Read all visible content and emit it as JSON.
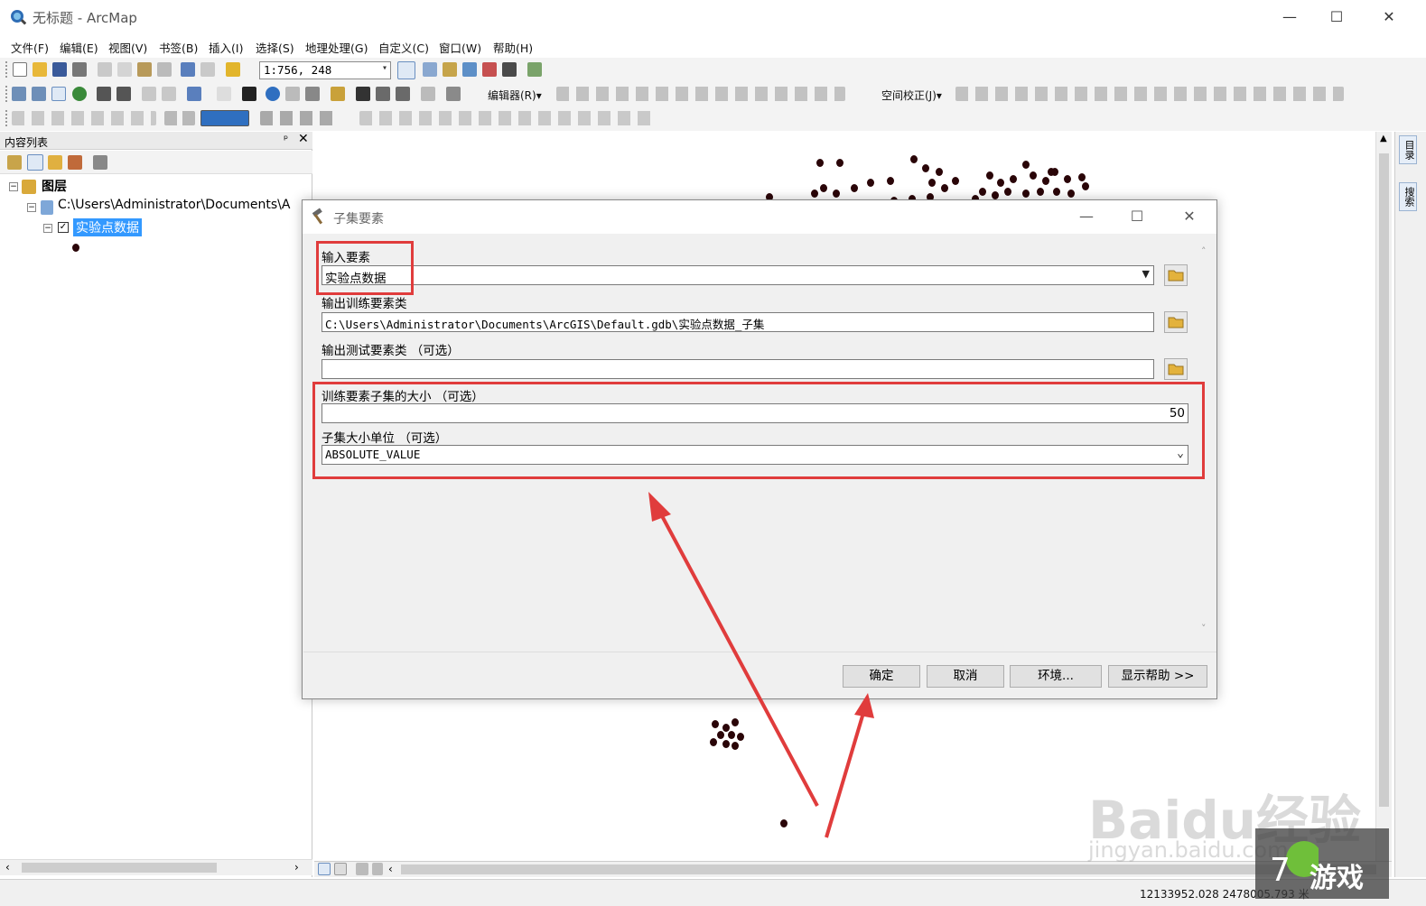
{
  "window": {
    "title": "无标题 - ArcMap",
    "minimize": "—",
    "maximize": "☐",
    "close": "✕"
  },
  "menu": [
    "文件(F)",
    "编辑(E)",
    "视图(V)",
    "书签(B)",
    "插入(I)",
    "选择(S)",
    "地理处理(G)",
    "自定义(C)",
    "窗口(W)",
    "帮助(H)"
  ],
  "toolbar": {
    "scale": "1:756, 248",
    "editor_label": "编辑器(R)▾",
    "spatial_adjust_label": "空间校正(J)▾"
  },
  "toc": {
    "title": "内容列表",
    "pin": "ᵖ",
    "close": "✕",
    "root": "图层",
    "datasource": "C:\\Users\\Administrator\\Documents\\A",
    "layer": "实验点数据",
    "expander_collapse": "−",
    "checkmark": "✓"
  },
  "side_tabs": [
    "目录",
    "搜索"
  ],
  "dialog": {
    "title": "子集要素",
    "input_features_label": "输入要素",
    "input_features_value": "实验点数据",
    "output_training_label": "输出训练要素类",
    "output_training_value": "C:\\Users\\Administrator\\Documents\\ArcGIS\\Default.gdb\\实验点数据_子集",
    "output_test_label": "输出测试要素类 （可选）",
    "output_test_value": "",
    "subset_size_label": "训练要素子集的大小 （可选）",
    "subset_size_value": "50",
    "subset_unit_label": "子集大小单位 （可选）",
    "subset_unit_value": "ABSOLUTE_VALUE",
    "buttons": {
      "ok": "确定",
      "cancel": "取消",
      "environments": "环境...",
      "show_help": "显示帮助 >>"
    }
  },
  "status": {
    "coords": "12133952.028  2478005.793 米"
  },
  "watermark": {
    "baidu": "Baidu经验",
    "url": "jingyan.baidu.com",
    "game": "游戏"
  },
  "colors": {
    "annotation_red": "#e03c3c",
    "map_point": "#2a0508",
    "selection_blue": "#3399ff"
  }
}
